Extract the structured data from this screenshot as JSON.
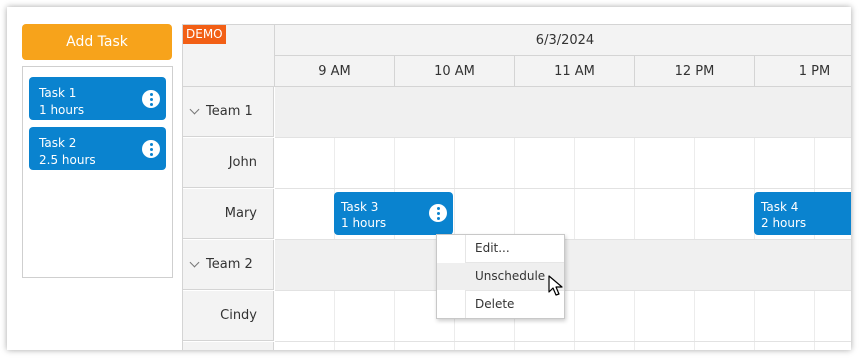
{
  "toolbar": {
    "add_task_label": "Add Task"
  },
  "unscheduled": [
    {
      "name": "Task 1",
      "duration": "1 hours"
    },
    {
      "name": "Task 2",
      "duration": "2.5 hours"
    }
  ],
  "scheduler": {
    "badge": "DEMO",
    "date": "6/3/2024",
    "hours": [
      "9 AM",
      "10 AM",
      "11 AM",
      "12 PM",
      "1 PM"
    ],
    "rows": [
      {
        "label": "Team 1",
        "type": "group"
      },
      {
        "label": "John",
        "type": "resource"
      },
      {
        "label": "Mary",
        "type": "resource"
      },
      {
        "label": "Team 2",
        "type": "group"
      },
      {
        "label": "Cindy",
        "type": "resource"
      }
    ],
    "events": [
      {
        "name": "Task 3",
        "duration": "1 hours"
      },
      {
        "name": "Task 4",
        "duration": "2 hours"
      }
    ]
  },
  "context_menu": {
    "items": [
      "Edit...",
      "Unschedule",
      "Delete"
    ],
    "hovered": "Unschedule"
  },
  "colors": {
    "accent": "#0a83cf",
    "add_button": "#f7a31b",
    "demo_badge": "#f25f15"
  }
}
